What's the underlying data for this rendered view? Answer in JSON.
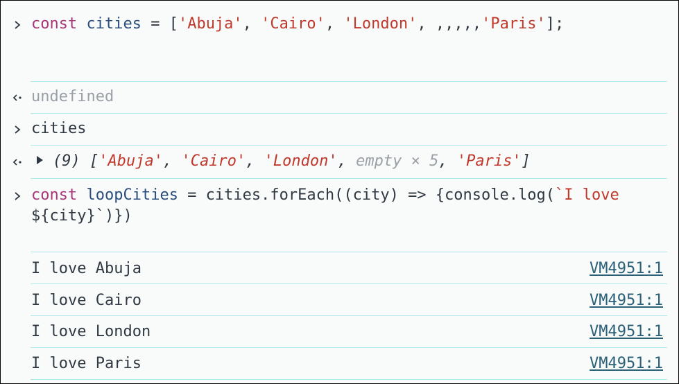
{
  "entries": [
    {
      "type": "input",
      "code": {
        "kw": "const",
        "name": "cities",
        "op": " = [",
        "s1": "'Abuja'",
        "c1": ", ",
        "s2": "'Cairo'",
        "c2": ", ",
        "s3": "'London'",
        "c3": ", ,,,,,",
        "s4": "'Paris'",
        "end": "];"
      }
    },
    {
      "type": "result",
      "text": "undefined"
    },
    {
      "type": "input",
      "text": "cities"
    },
    {
      "type": "array_result",
      "count": "(9)",
      "open": "[",
      "s1": "'Abuja'",
      "c1": ", ",
      "s2": "'Cairo'",
      "c2": ", ",
      "s3": "'London'",
      "c3": ", ",
      "empty": "empty × 5",
      "c4": ", ",
      "s4": "'Paris'",
      "close": "]"
    },
    {
      "type": "input",
      "code": {
        "kw": "const",
        "name": "loopCities",
        "rest": " = cities.forEach((city) => {console.log(",
        "tpl": "`I love ",
        "tail": "${city}`)})"
      }
    }
  ],
  "logs": [
    {
      "text": "I love Abuja",
      "source": "VM4951:1"
    },
    {
      "text": "I love Cairo",
      "source": "VM4951:1"
    },
    {
      "text": "I love London",
      "source": "VM4951:1"
    },
    {
      "text": "I love Paris",
      "source": "VM4951:1"
    }
  ]
}
